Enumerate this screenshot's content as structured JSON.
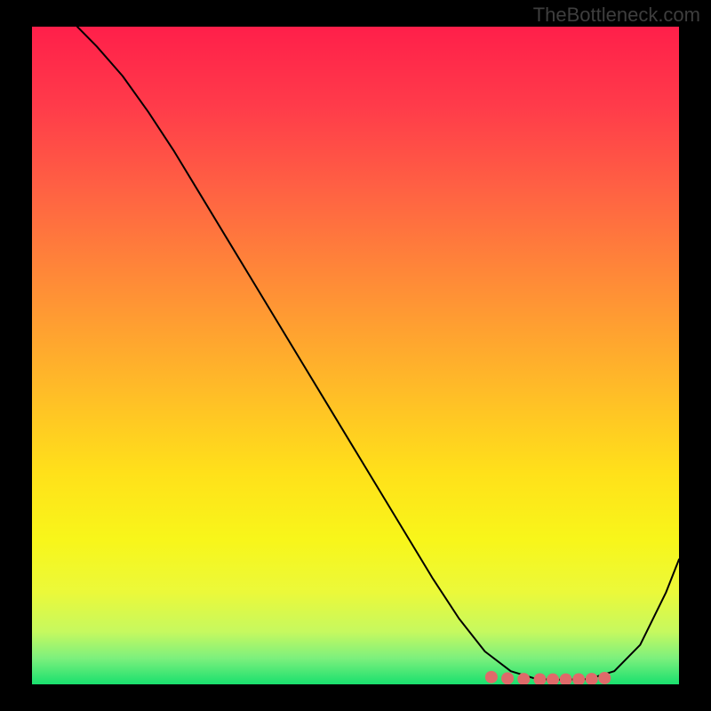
{
  "watermark": "TheBottleneck.com",
  "chart_data": {
    "type": "line",
    "title": "",
    "xlabel": "",
    "ylabel": "",
    "xlim": [
      0,
      100
    ],
    "ylim": [
      0,
      100
    ],
    "grid": false,
    "series": [
      {
        "name": "curve",
        "color": "#000000",
        "stroke_width": 2,
        "x": [
          7,
          10,
          14,
          18,
          22,
          26,
          30,
          34,
          38,
          42,
          46,
          50,
          54,
          58,
          62,
          66,
          70,
          74,
          78,
          82,
          86,
          90,
          94,
          98,
          100
        ],
        "y": [
          100,
          97,
          92.5,
          87,
          81,
          74.5,
          68,
          61.5,
          55,
          48.5,
          42,
          35.5,
          29,
          22.5,
          16,
          10,
          5,
          2,
          0.8,
          0.7,
          0.8,
          2,
          6,
          14,
          19
        ]
      },
      {
        "name": "highlight-dots",
        "type": "scatter",
        "color": "#df6a6a",
        "marker_size": 7,
        "x": [
          71,
          73.5,
          76,
          78.5,
          80.5,
          82.5,
          84.5,
          86.5,
          88.5
        ],
        "y": [
          1.1,
          0.9,
          0.8,
          0.75,
          0.72,
          0.73,
          0.75,
          0.8,
          0.95
        ]
      }
    ],
    "background": {
      "type": "vertical-gradient",
      "stops": [
        {
          "pos": 0.0,
          "color": "#ff1f4a"
        },
        {
          "pos": 0.12,
          "color": "#ff3b4a"
        },
        {
          "pos": 0.25,
          "color": "#ff6243"
        },
        {
          "pos": 0.4,
          "color": "#ff8f36"
        },
        {
          "pos": 0.55,
          "color": "#ffbb28"
        },
        {
          "pos": 0.68,
          "color": "#ffe11a"
        },
        {
          "pos": 0.78,
          "color": "#f8f61a"
        },
        {
          "pos": 0.86,
          "color": "#ebf93a"
        },
        {
          "pos": 0.92,
          "color": "#c6f95f"
        },
        {
          "pos": 0.96,
          "color": "#7df07d"
        },
        {
          "pos": 1.0,
          "color": "#19e06e"
        }
      ]
    }
  }
}
